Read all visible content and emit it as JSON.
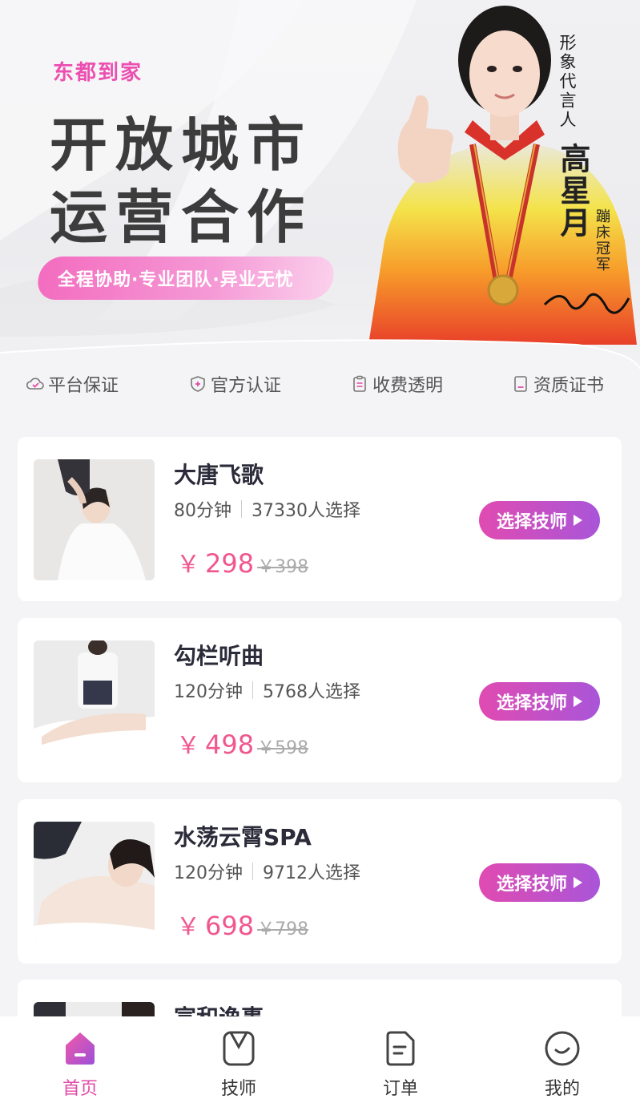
{
  "banner": {
    "brand": "东都到家",
    "headline_line1": "开放城市",
    "headline_line2": "运营合作",
    "slogan": "全程协助·专业团队·异业无忧",
    "spokesperson_title": "形象代言人",
    "spokesperson_name": "高星月",
    "spokesperson_role": "蹦床冠军"
  },
  "guarantees": [
    {
      "label": "平台保证",
      "icon": "cloud-check-icon"
    },
    {
      "label": "官方认证",
      "icon": "shield-plus-icon"
    },
    {
      "label": "收费透明",
      "icon": "clipboard-icon"
    },
    {
      "label": "资质证书",
      "icon": "certificate-icon"
    }
  ],
  "products": [
    {
      "name": "大唐飞歌",
      "duration": "80分钟",
      "chosen": "37330人选择",
      "currency": "￥",
      "price": "298",
      "old_price": "￥398",
      "button": "选择技师"
    },
    {
      "name": "勾栏听曲",
      "duration": "120分钟",
      "chosen": "5768人选择",
      "currency": "￥",
      "price": "498",
      "old_price": "￥598",
      "button": "选择技师"
    },
    {
      "name": "水荡云霄SPA",
      "duration": "120分钟",
      "chosen": "9712人选择",
      "currency": "￥",
      "price": "698",
      "old_price": "￥798",
      "button": "选择技师"
    },
    {
      "name": "宣和逸事"
    }
  ],
  "tabbar": [
    {
      "label": "首页",
      "icon": "home-icon",
      "active": true
    },
    {
      "label": "技师",
      "icon": "technician-icon",
      "active": false
    },
    {
      "label": "订单",
      "icon": "order-icon",
      "active": false
    },
    {
      "label": "我的",
      "icon": "profile-icon",
      "active": false
    }
  ],
  "colors": {
    "accent": "#e24ba6",
    "price": "#f0578f",
    "button_gradient_start": "#e04bb1",
    "button_gradient_end": "#a955d9"
  }
}
